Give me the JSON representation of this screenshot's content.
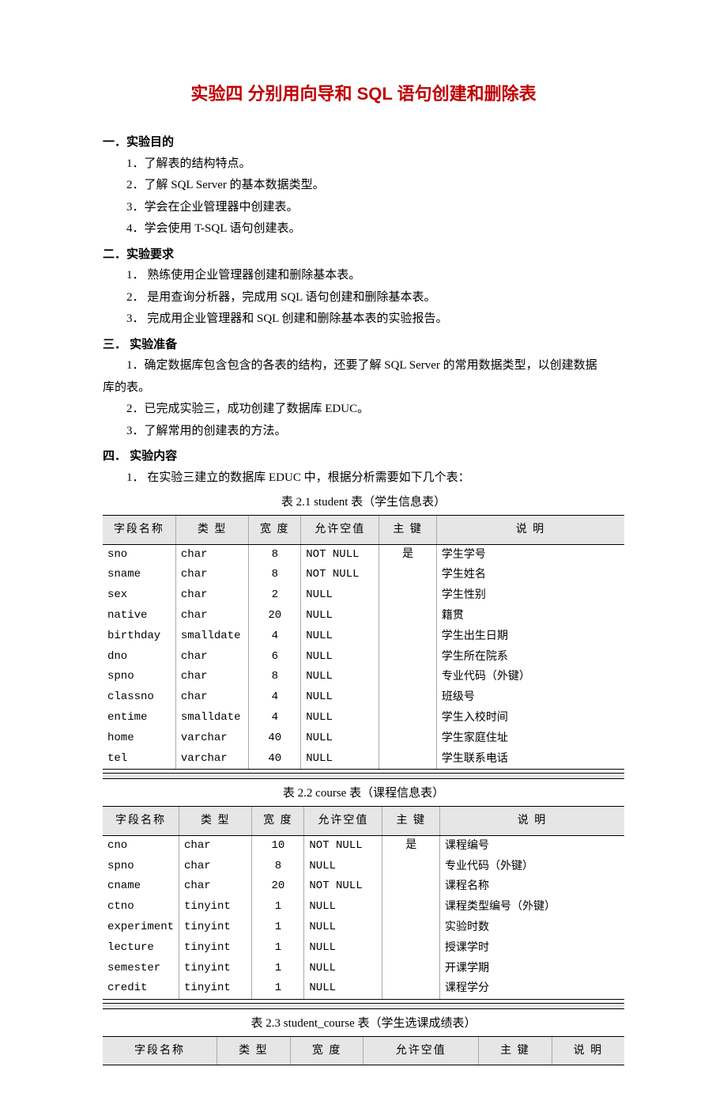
{
  "title": "实验四 分别用向导和 SQL 语句创建和删除表",
  "s1": {
    "heading": "一．实验目的",
    "items": [
      "1．了解表的结构特点。",
      "2．了解 SQL Server 的基本数据类型。",
      "3．学会在企业管理器中创建表。",
      "4．学会使用 T-SQL 语句创建表。"
    ]
  },
  "s2": {
    "heading": "二．实验要求",
    "items": [
      "1． 熟练使用企业管理器创建和删除基本表。",
      "2． 是用查询分析器，完成用 SQL 语句创建和删除基本表。",
      "3． 完成用企业管理器和 SQL 创建和删除基本表的实验报告。"
    ]
  },
  "s3": {
    "heading": "三． 实验准备",
    "p1a": "1．确定数据库包含包含的各表的结构，还要了解 SQL Server 的常用数据类型，以创建数据",
    "p1b": "库的表。",
    "items": [
      "2．已完成实验三，成功创建了数据库 EDUC。",
      "3．了解常用的创建表的方法。"
    ]
  },
  "s4": {
    "heading": "四． 实验内容",
    "intro": "1． 在实验三建立的数据库 EDUC 中，根据分析需要如下几个表："
  },
  "tableHeaders": {
    "field": "字段名称",
    "type": "类  型",
    "width": "宽  度",
    "null": "允许空值",
    "pk": "主  键",
    "desc": "说      明"
  },
  "captions": {
    "t1": "表 2.1   student 表（学生信息表）",
    "t2": "表 2.2   course 表（课程信息表）",
    "t3": "表 2.3   student_course 表（学生选课成绩表）"
  },
  "table1": [
    {
      "field": "sno",
      "type": "char",
      "width": "8",
      "null": "NOT NULL",
      "pk": "是",
      "desc": "学生学号"
    },
    {
      "field": "sname",
      "type": "char",
      "width": "8",
      "null": "NOT NULL",
      "pk": "",
      "desc": "学生姓名"
    },
    {
      "field": "sex",
      "type": "char",
      "width": "2",
      "null": "NULL",
      "pk": "",
      "desc": "学生性别"
    },
    {
      "field": "native",
      "type": "char",
      "width": "20",
      "null": "NULL",
      "pk": "",
      "desc": "籍贯"
    },
    {
      "field": "birthday",
      "type": "smalldate",
      "width": "4",
      "null": "NULL",
      "pk": "",
      "desc": "学生出生日期"
    },
    {
      "field": "dno",
      "type": "char",
      "width": "6",
      "null": "NULL",
      "pk": "",
      "desc": "学生所在院系"
    },
    {
      "field": "spno",
      "type": "char",
      "width": "8",
      "null": "NULL",
      "pk": "",
      "desc": "专业代码（外键）"
    },
    {
      "field": "classno",
      "type": "char",
      "width": "4",
      "null": "NULL",
      "pk": "",
      "desc": "班级号"
    },
    {
      "field": "entime",
      "type": "smalldate",
      "width": "4",
      "null": "NULL",
      "pk": "",
      "desc": "学生入校时间"
    },
    {
      "field": "home",
      "type": "varchar",
      "width": "40",
      "null": "NULL",
      "pk": "",
      "desc": "学生家庭住址"
    },
    {
      "field": "tel",
      "type": "varchar",
      "width": "40",
      "null": "NULL",
      "pk": "",
      "desc": "学生联系电话"
    }
  ],
  "table2": [
    {
      "field": "cno",
      "type": "char",
      "width": "10",
      "null": "NOT NULL",
      "pk": "是",
      "desc": "课程编号"
    },
    {
      "field": "spno",
      "type": "char",
      "width": "8",
      "null": "NULL",
      "pk": "",
      "desc": "专业代码（外键）"
    },
    {
      "field": "cname",
      "type": "char",
      "width": "20",
      "null": "NOT NULL",
      "pk": "",
      "desc": "课程名称"
    },
    {
      "field": "ctno",
      "type": "tinyint",
      "width": "1",
      "null": "NULL",
      "pk": "",
      "desc": "课程类型编号（外键）"
    },
    {
      "field": "experiment",
      "type": "tinyint",
      "width": "1",
      "null": "NULL",
      "pk": "",
      "desc": "实验时数"
    },
    {
      "field": "lecture",
      "type": "tinyint",
      "width": "1",
      "null": "NULL",
      "pk": "",
      "desc": "授课学时"
    },
    {
      "field": "semester",
      "type": "tinyint",
      "width": "1",
      "null": "NULL",
      "pk": "",
      "desc": "开课学期"
    },
    {
      "field": "credit",
      "type": "tinyint",
      "width": "1",
      "null": "NULL",
      "pk": "",
      "desc": "课程学分"
    }
  ]
}
